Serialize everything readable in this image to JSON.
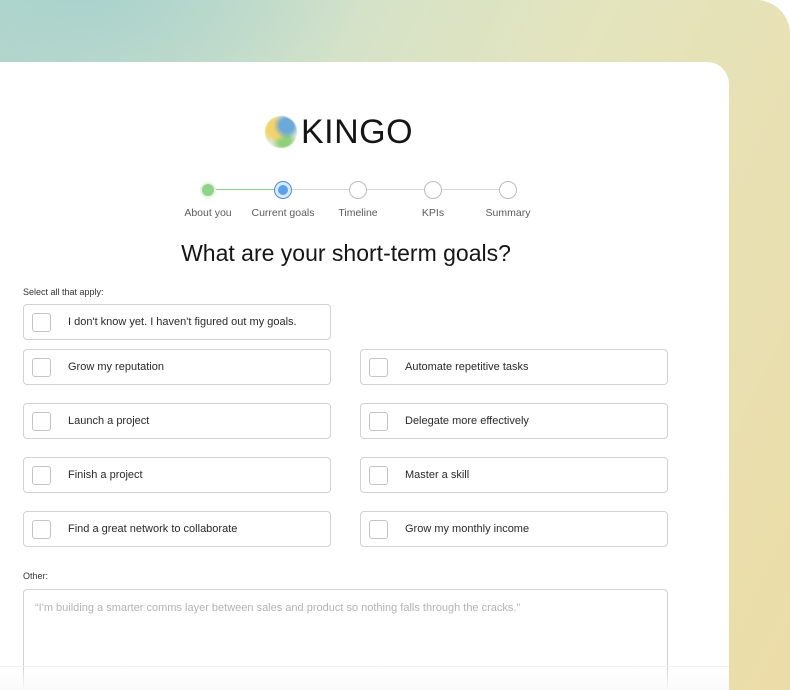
{
  "brand": {
    "name": "KINGO",
    "logo_icon": "kingo-orb-logo"
  },
  "stepper": {
    "steps": [
      {
        "label": "About you",
        "state": "complete"
      },
      {
        "label": "Current goals",
        "state": "current"
      },
      {
        "label": "Timeline",
        "state": "upcoming"
      },
      {
        "label": "KPIs",
        "state": "upcoming"
      },
      {
        "label": "Summary",
        "state": "upcoming"
      }
    ]
  },
  "question": {
    "title": "What are your short-term goals?",
    "hint": "Select all that apply:"
  },
  "options": [
    {
      "label": "I don't know yet. I haven't figured out my goals.",
      "checked": false
    },
    {
      "label": "Grow my reputation",
      "checked": false
    },
    {
      "label": "Automate repetitive tasks",
      "checked": false
    },
    {
      "label": "Launch a project",
      "checked": false
    },
    {
      "label": "Delegate more effectively",
      "checked": false
    },
    {
      "label": "Finish a project",
      "checked": false
    },
    {
      "label": "Master a skill",
      "checked": false
    },
    {
      "label": "Find a great network to collaborate",
      "checked": false
    },
    {
      "label": "Grow my monthly income",
      "checked": false
    }
  ],
  "other": {
    "label": "Other:",
    "placeholder": "“I'm building a smarter comms layer between sales and product so nothing falls through the cracks.”"
  },
  "colors": {
    "step_complete": "#8fd38a",
    "step_current": "#5aa2ea",
    "border": "#d2d2d2"
  }
}
